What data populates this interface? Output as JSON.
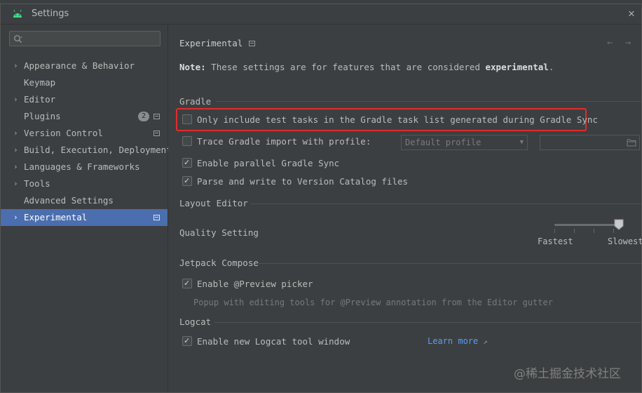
{
  "window": {
    "title": "Settings"
  },
  "sidebar": {
    "search_placeholder": "",
    "items": [
      {
        "label": "Appearance & Behavior",
        "expandable": true
      },
      {
        "label": "Keymap",
        "expandable": false
      },
      {
        "label": "Editor",
        "expandable": true
      },
      {
        "label": "Plugins",
        "expandable": false,
        "badge": "2"
      },
      {
        "label": "Version Control",
        "expandable": true
      },
      {
        "label": "Build, Execution, Deployment",
        "expandable": true
      },
      {
        "label": "Languages & Frameworks",
        "expandable": true
      },
      {
        "label": "Tools",
        "expandable": true
      },
      {
        "label": "Advanced Settings",
        "expandable": false
      },
      {
        "label": "Experimental",
        "expandable": true,
        "selected": true
      }
    ]
  },
  "main": {
    "title": "Experimental",
    "note_prefix": "Note:",
    "note_text": " These settings are for features that are considered ",
    "note_emphasis": "experimental",
    "note_suffix": ".",
    "gradle": {
      "title": "Gradle",
      "only_test_tasks": {
        "label": "Only include test tasks in the Gradle task list generated during Gradle Sync",
        "checked": false
      },
      "trace_import": {
        "label": "Trace Gradle import with profile:",
        "checked": false
      },
      "profile_select": "Default profile",
      "parallel_sync": {
        "label": "Enable parallel Gradle Sync",
        "checked": true
      },
      "version_catalog": {
        "label": "Parse and write to Version Catalog files",
        "checked": true
      }
    },
    "layout_editor": {
      "title": "Layout Editor",
      "quality_label": "Quality Setting",
      "slider_min_label": "Fastest",
      "slider_max_label": "Slowest",
      "slider_value_fraction": 1.0
    },
    "compose": {
      "title": "Jetpack Compose",
      "preview_picker": {
        "label": "Enable @Preview picker",
        "checked": true
      },
      "preview_hint": "Popup with editing tools for @Preview annotation from the Editor gutter"
    },
    "logcat": {
      "title": "Logcat",
      "new_window": {
        "label": "Enable new Logcat tool window",
        "checked": true
      },
      "learn_more": "Learn more"
    }
  },
  "watermark": "@稀土掘金技术社区",
  "colors": {
    "selection": "#4b6eaf",
    "highlight_border": "#e02c2c",
    "link": "#589df6",
    "android": "#3ddc84"
  }
}
